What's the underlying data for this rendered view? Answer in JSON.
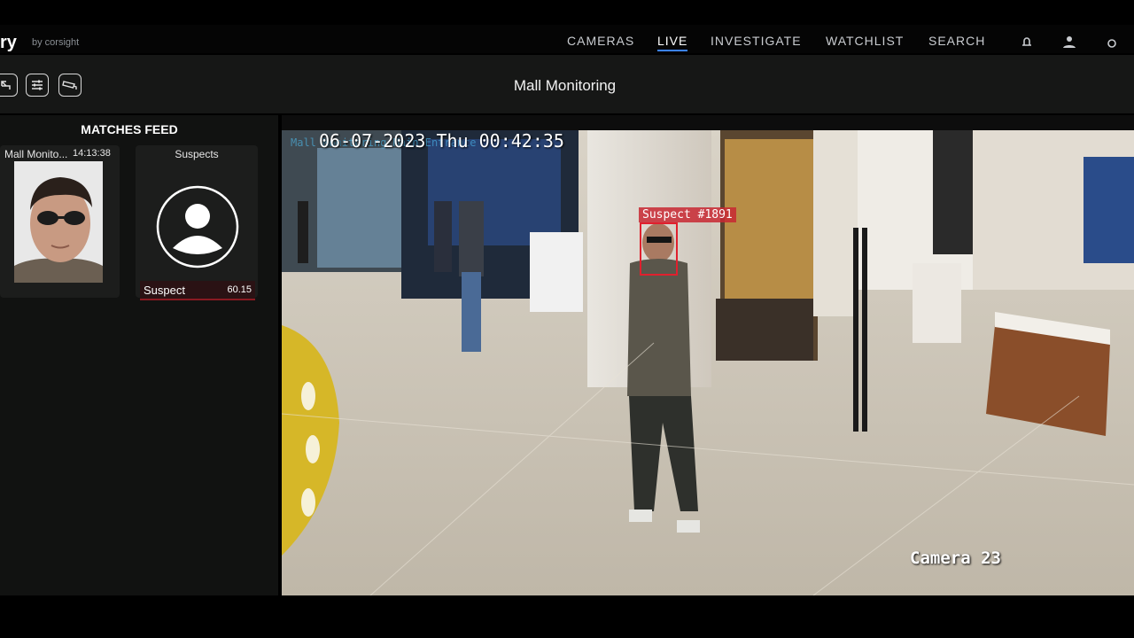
{
  "brand": {
    "name": "ry",
    "sub": "by corsight"
  },
  "nav": {
    "items": [
      "CAMERAS",
      "LIVE",
      "INVESTIGATE",
      "WATCHLIST",
      "SEARCH"
    ],
    "active": "LIVE"
  },
  "toolbar": {
    "title": "Mall Monitoring"
  },
  "feed": {
    "title": "MATCHES FEED",
    "match": {
      "camera": "Mall Monito...",
      "time": "14:13:38"
    },
    "watchlist": {
      "name": "Suspects",
      "label": "Suspect",
      "score": "60.15"
    }
  },
  "video": {
    "timestamp": "06-07-2023 Thu 00:42:35",
    "overlay_text": "Mall Monitoring Main Entrance",
    "detection_label": "Suspect #1891",
    "camera_label": "Camera 23"
  },
  "colors": {
    "accent": "#3b82f6",
    "alert": "#e0202e"
  }
}
